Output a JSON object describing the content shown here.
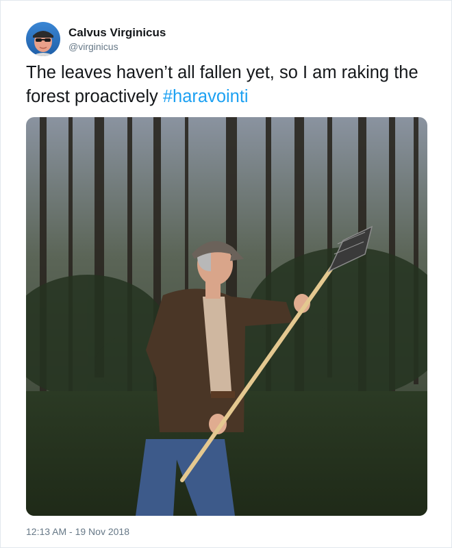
{
  "tweet": {
    "author": {
      "display_name": "Calvus Virginicus",
      "handle": "@virginicus"
    },
    "text": "The leaves haven’t all fallen yet, so I am raking the forest proactively ",
    "hashtag": "#haravointi",
    "timestamp": "12:13 AM - 19 Nov 2018"
  },
  "colors": {
    "link": "#1da1f2",
    "text": "#14171a",
    "muted": "#657786",
    "border": "#e1e8ed"
  }
}
